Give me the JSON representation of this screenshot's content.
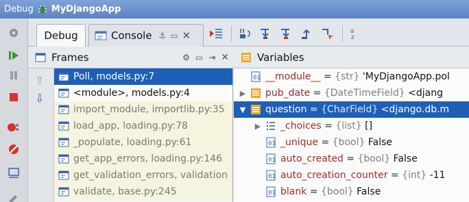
{
  "title_bar": {
    "prefix": "Debug",
    "app_name": "MyDjangoApp"
  },
  "toolbar": {
    "debug_tab": "Debug",
    "console_tab": "Console"
  },
  "frames": {
    "title": "Frames",
    "items": [
      {
        "label": "Poll, models.py:7",
        "state": "selected"
      },
      {
        "label": "<module>, models.py:4",
        "state": "current"
      },
      {
        "label": "import_module, importlib.py:35",
        "state": "library"
      },
      {
        "label": "load_app, loading.py:78",
        "state": "library"
      },
      {
        "label": "_populate, loading.py:61",
        "state": "library"
      },
      {
        "label": "get_app_errors, loading.py:146",
        "state": "library"
      },
      {
        "label": "get_validation_errors, validation",
        "state": "library"
      },
      {
        "label": "validate, base.py:245",
        "state": "library"
      }
    ]
  },
  "variables": {
    "title": "Variables",
    "items": [
      {
        "indent": 0,
        "expander": "",
        "icon": "field-icon",
        "name": "__module__",
        "eq": " = ",
        "type": "{str}",
        "value": " 'MyDjangoApp.pol",
        "selected": false
      },
      {
        "indent": 0,
        "expander": "▶",
        "icon": "object-icon",
        "name": "pub_date",
        "eq": " = ",
        "type": "{DateTimeField}",
        "value": " <djang",
        "selected": false
      },
      {
        "indent": 0,
        "expander": "▼",
        "icon": "object-icon",
        "name": "question",
        "eq": " = ",
        "type": "{CharField}",
        "value": " <django.db.m",
        "selected": true
      },
      {
        "indent": 1,
        "expander": "▶",
        "icon": "list-icon",
        "name": "_choices",
        "eq": " = ",
        "type": "{list}",
        "value": " []",
        "selected": false
      },
      {
        "indent": 1,
        "expander": "",
        "icon": "field-icon",
        "name": "_unique",
        "eq": " = ",
        "type": "{bool}",
        "value": " False",
        "selected": false
      },
      {
        "indent": 1,
        "expander": "",
        "icon": "field-icon",
        "name": "auto_created",
        "eq": " = ",
        "type": "{bool}",
        "value": " False",
        "selected": false
      },
      {
        "indent": 1,
        "expander": "",
        "icon": "field-icon",
        "name": "auto_creation_counter",
        "eq": " = ",
        "type": "{int}",
        "value": " -11",
        "selected": false
      },
      {
        "indent": 1,
        "expander": "",
        "icon": "field-icon",
        "name": "blank",
        "eq": " = ",
        "type": "{bool}",
        "value": " False",
        "selected": false
      }
    ]
  },
  "colors": {
    "selection": "#1e5fb8",
    "var_name": "#a32a2a",
    "title_bar": "#6b8fcc",
    "library_frame_bg": "#f6f3df"
  }
}
